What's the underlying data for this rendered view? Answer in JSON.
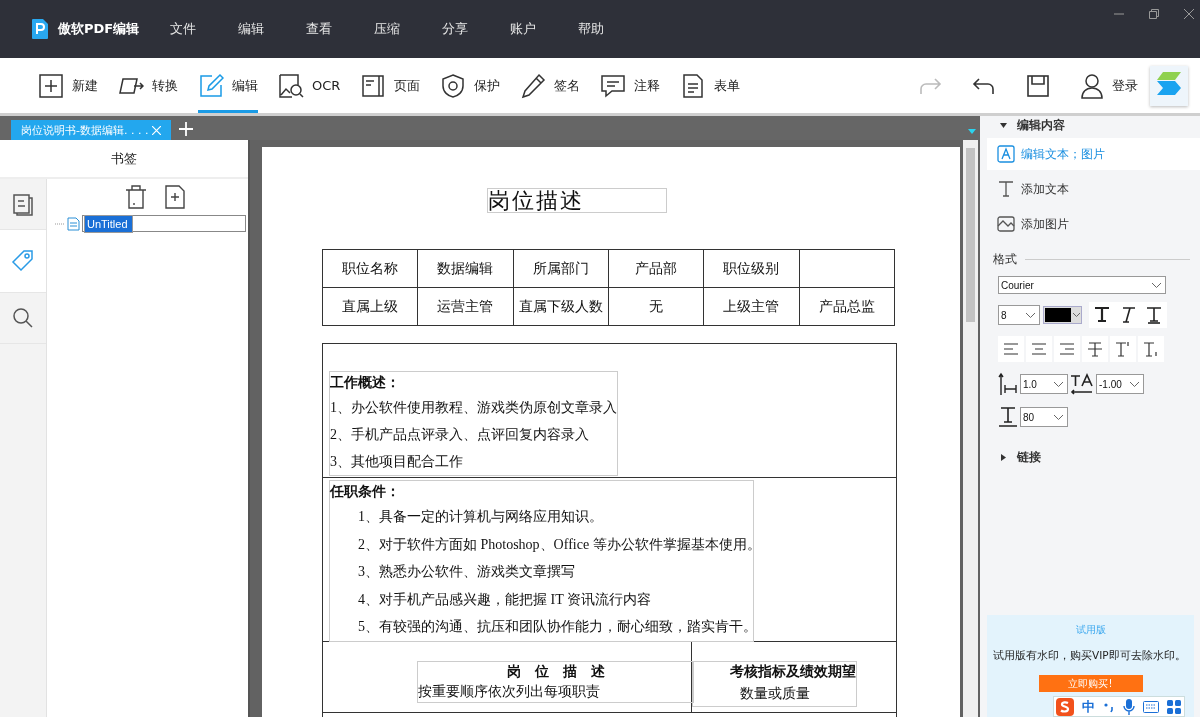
{
  "app": {
    "name": "傲软PDF编辑"
  },
  "menu": [
    "文件",
    "编辑",
    "查看",
    "压缩",
    "分享",
    "账户",
    "帮助"
  ],
  "toolbar": {
    "tools": [
      {
        "label": "新建",
        "selected": false
      },
      {
        "label": "转换",
        "selected": false
      },
      {
        "label": "编辑",
        "selected": true
      },
      {
        "label": "OCR",
        "selected": false
      },
      {
        "label": "页面",
        "selected": false
      },
      {
        "label": "保护",
        "selected": false
      },
      {
        "label": "签名",
        "selected": false
      },
      {
        "label": "注释",
        "selected": false
      },
      {
        "label": "表单",
        "selected": false
      }
    ],
    "actions": [
      {
        "disabled": true
      },
      {
        "disabled": false
      },
      {
        "disabled": false
      }
    ],
    "login": "登录"
  },
  "document_tabs": [
    {
      "label": "岗位说明书-数据编辑. . . .",
      "selected": true
    }
  ],
  "bookmarks": {
    "title": "书签",
    "rail": [
      {
        "selected": false
      },
      {
        "selected": true
      },
      {
        "selected": false
      }
    ],
    "items": [
      {
        "label": "UnTitled",
        "selected": true
      }
    ]
  },
  "page": {
    "title": "岗位描述",
    "info_table": [
      [
        "职位名称",
        "数据编辑",
        "所属部门",
        "产品部",
        "职位级别"
      ],
      [
        "直属上级",
        "运营主管",
        "直属下级人数",
        "无",
        "上级主管",
        "产品总监"
      ]
    ],
    "overview": {
      "title": "工作概述：",
      "items": [
        "1、办公软件使用教程、游戏类伪原创文章录入",
        "2、手机产品点评录入、点评回复内容录入",
        "3、其他项目配合工作"
      ]
    },
    "requirements": {
      "title": "任职条件：",
      "items": [
        "1、具备一定的计算机与网络应用知识。",
        "2、对于软件方面如 Photoshop、Office 等办公软件掌握基本使用。",
        "3、熟悉办公软件、游戏类文章撰写",
        "4、对手机产品感兴趣，能把握 IT 资讯流行内容",
        "5、有较强的沟通、抗压和团队协作能力，耐心细致，踏实肯干。"
      ]
    },
    "duties": {
      "title": "岗　位　描　述",
      "subtitle": "按重要顺序依次列出每项职责"
    },
    "kpi": {
      "title": "考核指标及绩效期望",
      "subtitle": "数量或质量"
    }
  },
  "properties": {
    "edit_section": {
      "title": "编辑内容",
      "expanded": true,
      "items": [
        {
          "label": "编辑文本；图片",
          "selected": true
        },
        {
          "label": "添加文本",
          "selected": false
        },
        {
          "label": "添加图片",
          "selected": false
        }
      ]
    },
    "format": {
      "title": "格式",
      "font": "Courier",
      "size": "8",
      "line_spacing": "1.0",
      "char_spacing": "-1.00",
      "scale": "80"
    },
    "link_section": {
      "title": "链接",
      "expanded": false
    }
  },
  "trial": {
    "title": "试用版",
    "message": "试用版有水印，购买VIP即可去除水印。",
    "button": "立即购买!"
  },
  "ime": {
    "label": "中"
  }
}
